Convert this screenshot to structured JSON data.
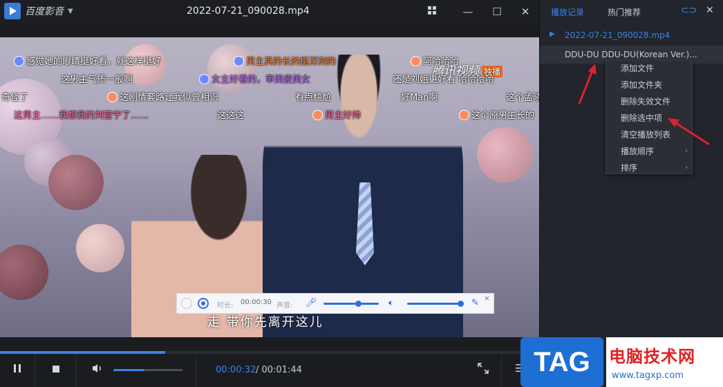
{
  "app": {
    "name": "百度影音",
    "file_title": "2022-07-21_090028.mp4"
  },
  "danmaku": [
    {
      "text": "感觉她的眼睛挺好看，就这样挺好",
      "color": "#ffffff"
    },
    {
      "text": "男主真的长的挺深刻的",
      "color": "#ff8a3d"
    },
    {
      "text": "阿哈哈哈",
      "color": "#ffffff"
    },
    {
      "text": "这男主气质一般啊",
      "color": "#ffffff"
    },
    {
      "text": "女主好看的，审美疲美女",
      "color": "#c070ff"
    },
    {
      "text": "还是刘姐更好看 哈哈哈哈",
      "color": "#ffffff"
    },
    {
      "text": "奇怪了",
      "color": "#ffffff"
    },
    {
      "text": "这剧情套路让我似曾相识",
      "color": "#ffffff"
    },
    {
      "text": "有点尴尬",
      "color": "#ffffff"
    },
    {
      "text": "好Man啊",
      "color": "#ffffff"
    },
    {
      "text": "这个孟晓",
      "color": "#ffffff"
    },
    {
      "text": "这男主……我想我的刘营宁了……",
      "color": "#ff6aa8"
    },
    {
      "text": "这这这",
      "color": "#ffffff"
    },
    {
      "text": "男主好帅",
      "color": "#ff6aa8"
    },
    {
      "text": "这个原男主长的",
      "color": "#ffffff"
    }
  ],
  "watermark": {
    "text": "腾讯视频",
    "tag": "独播"
  },
  "subtitle": "走 带你先离开这儿",
  "record_bar": {
    "duration_label": "时长:",
    "duration_value": "00:00:30",
    "sound_label": "声音:",
    "close": "×"
  },
  "player": {
    "current_time": "00:00:32",
    "total_time": "/ 00:01:44",
    "progress_fraction": 0.307,
    "volume_fraction": 0.45
  },
  "sidebar": {
    "tab_history": "播放记录",
    "tab_hot": "热门推荐",
    "playlist": [
      {
        "title": "2022-07-21_090028.mp4",
        "state": "playing"
      },
      {
        "title": "DDU-DU DDU-DU(Korean Ver.)...",
        "state": "selected"
      }
    ]
  },
  "context_menu": [
    {
      "label": "添加文件",
      "submenu": false
    },
    {
      "label": "添加文件夹",
      "submenu": false
    },
    {
      "label": "删除失效文件",
      "submenu": false
    },
    {
      "label": "删除选中项",
      "submenu": false
    },
    {
      "label": "清空播放列表",
      "submenu": false
    },
    {
      "label": "播放顺序",
      "submenu": true
    },
    {
      "label": "排序",
      "submenu": true
    }
  ],
  "site_watermark": {
    "tag": "TAG",
    "name": "电脑技术网",
    "url": "www.tagxp.com"
  },
  "colors": {
    "accent": "#3d82e8",
    "arrow": "#e02030"
  }
}
